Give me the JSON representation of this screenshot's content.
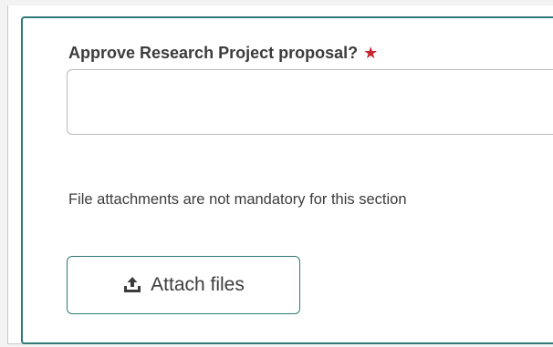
{
  "form": {
    "question_label": "Approve Research Project proposal?",
    "required_marker": "★",
    "answer_value": "",
    "attachment_note": "File attachments are not mandatory for this section",
    "attach_button_label": "Attach files",
    "icons": {
      "attach": "upload-icon",
      "required": "star-icon"
    }
  },
  "colors": {
    "accent": "#2f7a78",
    "required": "#c8262e",
    "text": "#3c3c3c"
  }
}
